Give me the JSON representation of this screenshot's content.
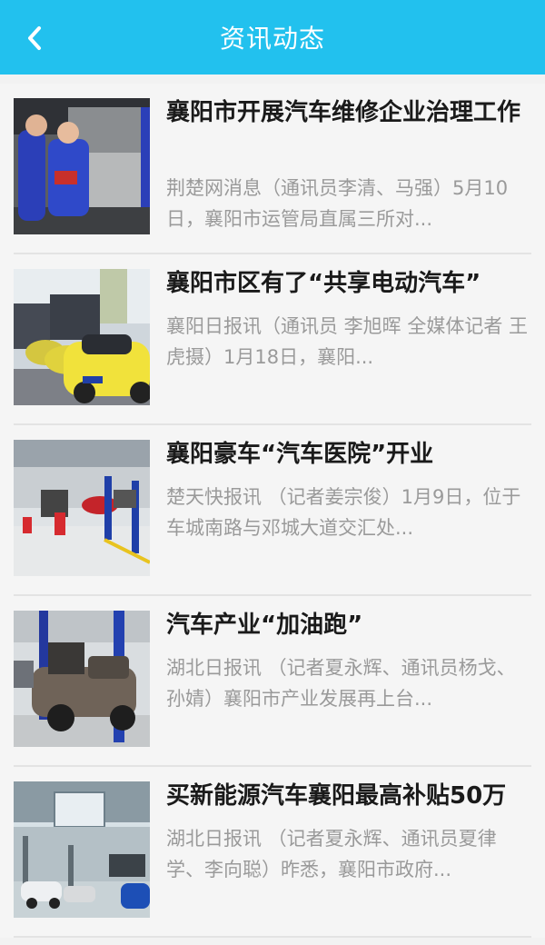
{
  "header": {
    "title": "资讯动态",
    "back_icon": "chevron-left-icon",
    "color": "#22c1ee"
  },
  "news": [
    {
      "title": "襄阳市开展汽车维修企业治理工作",
      "summary": "荆楚网消息（通讯员李清、马强）5月10日，襄阳市运管局直属三所对...",
      "image": "mechanics-repairing-car"
    },
    {
      "title": "襄阳市区有了“共享电动汽车”",
      "summary": "襄阳日报讯（通讯员 李旭晖 全媒体记者 王虎摄）1月18日，襄阳...",
      "image": "yellow-shared-electric-cars"
    },
    {
      "title": "襄阳豪车“汽车医院”开业",
      "summary": "楚天快报讯 （记者姜宗俊）1月9日，位于车城南路与邓城大道交汇处...",
      "image": "car-service-workshop"
    },
    {
      "title": "汽车产业“加油跑”",
      "summary": "湖北日报讯 （记者夏永辉、通讯员杨戈、孙婧）襄阳市产业发展再上台...",
      "image": "suv-on-lift"
    },
    {
      "title": "买新能源汽车襄阳最高补贴50万",
      "summary": "湖北日报讯 （记者夏永辉、通讯员夏律学、李向聪）昨悉，襄阳市政府...",
      "image": "car-showroom-hall"
    }
  ]
}
